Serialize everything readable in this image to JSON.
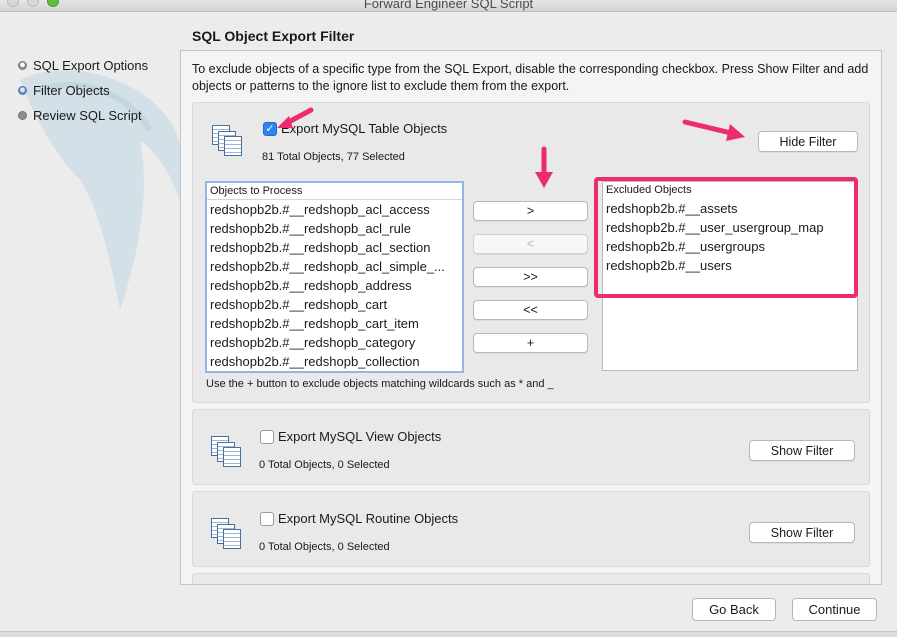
{
  "window": {
    "title": "Forward Engineer SQL Script"
  },
  "sidebar": {
    "steps": [
      {
        "label": "SQL Export Options",
        "state": "done"
      },
      {
        "label": "Filter Objects",
        "state": "active"
      },
      {
        "label": "Review SQL Script",
        "state": "todo"
      }
    ]
  },
  "page": {
    "title": "SQL Object Export Filter",
    "description": "To exclude objects of a specific type from the SQL Export, disable the corresponding checkbox. Press Show Filter and add objects or patterns to the ignore list to exclude them from the export."
  },
  "tables_group": {
    "checkbox_label": "Export MySQL Table Objects",
    "checked": true,
    "count_text": "81 Total Objects, 77 Selected",
    "filter_button": "Hide Filter",
    "to_process": {
      "header": "Objects to Process",
      "items": [
        "redshopb2b.#__redshopb_acl_access",
        "redshopb2b.#__redshopb_acl_rule",
        "redshopb2b.#__redshopb_acl_section",
        "redshopb2b.#__redshopb_acl_simple_...",
        "redshopb2b.#__redshopb_address",
        "redshopb2b.#__redshopb_cart",
        "redshopb2b.#__redshopb_cart_item",
        "redshopb2b.#__redshopb_category",
        "redshopb2b.#__redshopb_collection"
      ]
    },
    "excluded": {
      "header": "Excluded Objects",
      "items": [
        "redshopb2b.#__assets",
        "redshopb2b.#__user_usergroup_map",
        "redshopb2b.#__usergroups",
        "redshopb2b.#__users"
      ]
    },
    "move_buttons": {
      "exclude": ">",
      "include": "<",
      "exclude_all": ">>",
      "include_all": "<<",
      "add": "+"
    },
    "hint": "Use the + button to exclude objects matching wildcards such as * and _"
  },
  "views_group": {
    "checkbox_label": "Export MySQL View Objects",
    "checked": false,
    "count_text": "0 Total Objects, 0 Selected",
    "filter_button": "Show Filter"
  },
  "routines_group": {
    "checkbox_label": "Export MySQL Routine Objects",
    "checked": false,
    "count_text": "0 Total Objects, 0 Selected",
    "filter_button": "Show Filter"
  },
  "footer": {
    "back_button": "Go Back",
    "continue_button": "Continue"
  },
  "colors": {
    "annotation": "#ec2c6c",
    "accent": "#2f83ef"
  }
}
